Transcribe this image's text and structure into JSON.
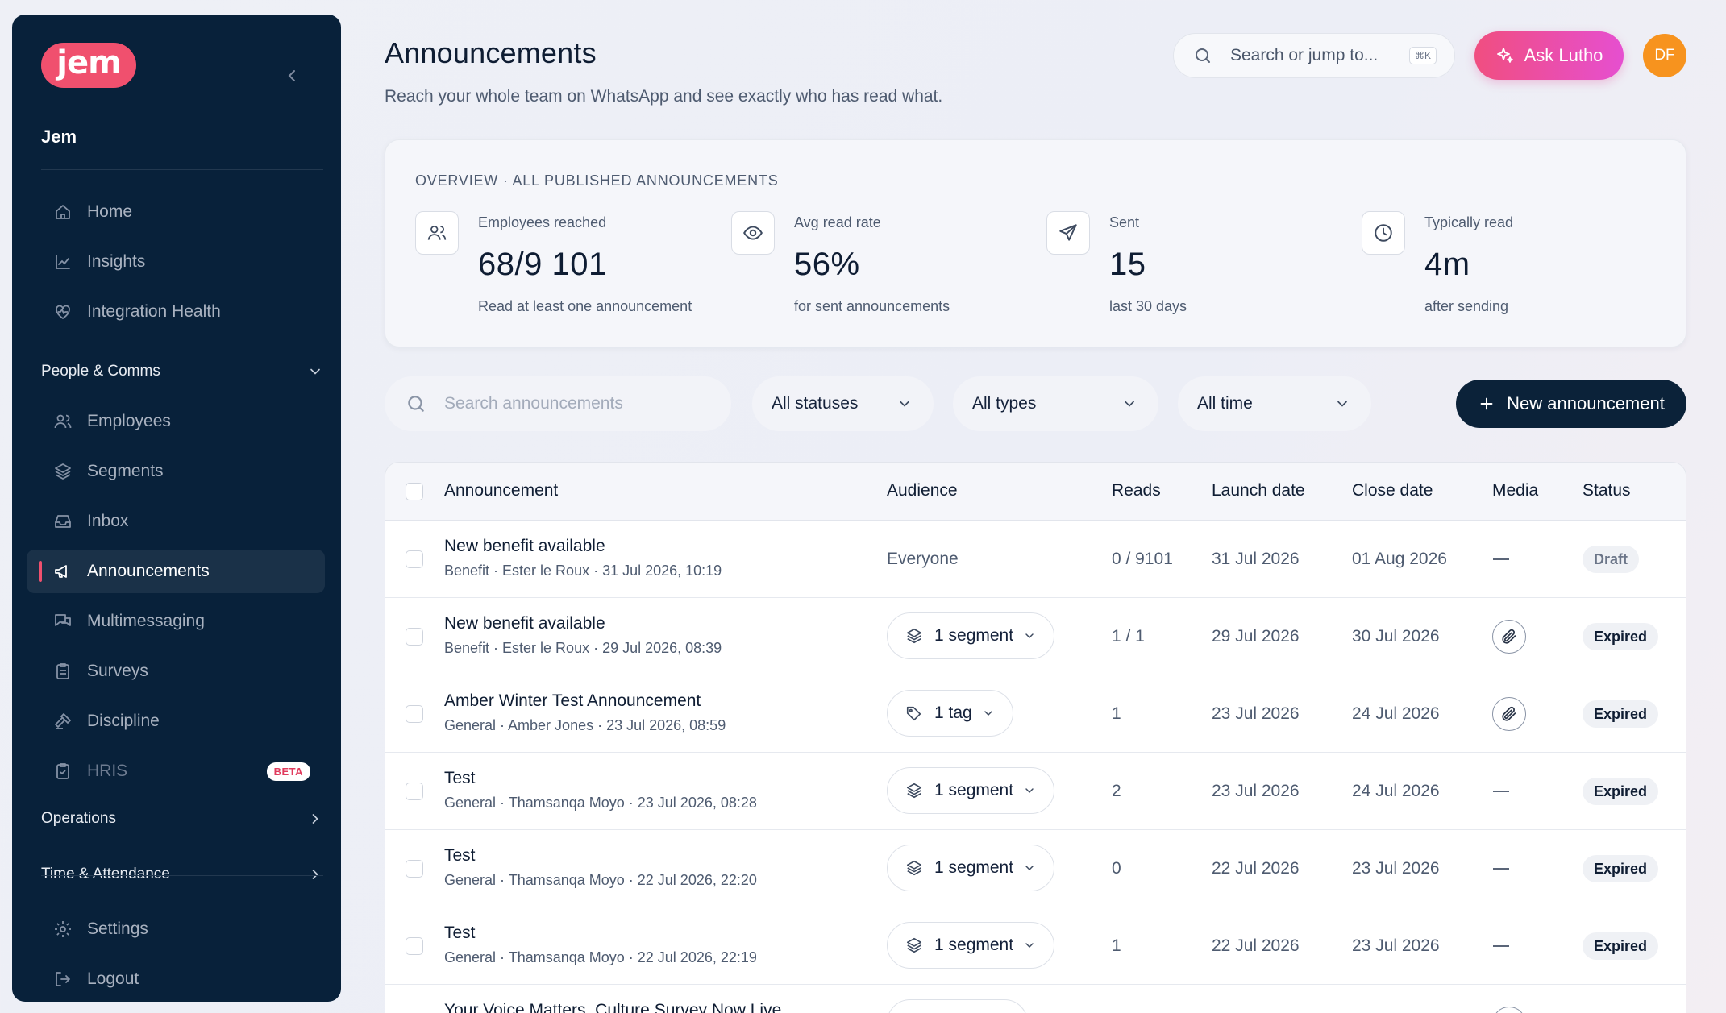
{
  "sidebar": {
    "logo": "jem",
    "org_name": "Jem",
    "items_top": [
      {
        "label": "Home",
        "icon": "home-icon"
      },
      {
        "label": "Insights",
        "icon": "chart-line-icon"
      },
      {
        "label": "Integration Health",
        "icon": "heart-pulse-icon"
      }
    ],
    "people_section": "People & Comms",
    "items_people": [
      {
        "label": "Employees",
        "icon": "users-icon"
      },
      {
        "label": "Segments",
        "icon": "layers-icon"
      },
      {
        "label": "Inbox",
        "icon": "inbox-icon"
      },
      {
        "label": "Announcements",
        "icon": "megaphone-icon",
        "active": true
      },
      {
        "label": "Multimessaging",
        "icon": "chat-icon"
      },
      {
        "label": "Surveys",
        "icon": "clipboard-icon"
      },
      {
        "label": "Discipline",
        "icon": "gavel-icon"
      },
      {
        "label": "HRIS",
        "icon": "clipboard-check-icon",
        "badge": "BETA"
      }
    ],
    "operations_section": "Operations",
    "time_section": "Time & Attendance",
    "items_bottom": [
      {
        "label": "Settings",
        "icon": "gear-icon"
      },
      {
        "label": "Logout",
        "icon": "logout-icon"
      }
    ]
  },
  "header": {
    "title": "Announcements",
    "subtitle": "Reach your whole team on WhatsApp and see exactly who has read what.",
    "search_placeholder": "Search or jump to...",
    "search_shortcut": "⌘K",
    "ask_label": "Ask Lutho",
    "avatar_initials": "DF"
  },
  "overview": {
    "label": "OVERVIEW · ALL PUBLISHED ANNOUNCEMENTS",
    "stats": [
      {
        "label": "Employees reached",
        "value": "68/9 101",
        "sub": "Read at least one announcement",
        "icon": "users-icon"
      },
      {
        "label": "Avg read rate",
        "value": "56%",
        "sub": "for sent announcements",
        "icon": "eye-icon"
      },
      {
        "label": "Sent",
        "value": "15",
        "sub": "last 30 days",
        "icon": "send-icon"
      },
      {
        "label": "Typically read",
        "value": "4m",
        "sub": "after sending",
        "icon": "clock-icon"
      }
    ]
  },
  "filters": {
    "search_placeholder": "Search announcements",
    "status": "All statuses",
    "type": "All types",
    "time": "All time",
    "new_label": "New announcement"
  },
  "table": {
    "headers": {
      "announcement": "Announcement",
      "audience": "Audience",
      "reads": "Reads",
      "launch": "Launch date",
      "close": "Close date",
      "media": "Media",
      "status": "Status"
    },
    "rows": [
      {
        "title": "New benefit available",
        "meta": "Benefit · Ester le Roux · 31 Jul 2026, 10:19",
        "audience": "Everyone",
        "audience_type": "text",
        "reads": "0 / 9101",
        "launch": "31 Jul 2026",
        "close": "01 Aug 2026",
        "media": false,
        "status": "Draft"
      },
      {
        "title": "New benefit available",
        "meta": "Benefit · Ester le Roux · 29 Jul 2026, 08:39",
        "audience": "1 segment",
        "audience_type": "segment",
        "reads": "1 / 1",
        "launch": "29 Jul 2026",
        "close": "30 Jul 2026",
        "media": true,
        "status": "Expired"
      },
      {
        "title": "Amber Winter Test Announcement",
        "meta": "General · Amber Jones · 23 Jul 2026, 08:59",
        "audience": "1 tag",
        "audience_type": "tag",
        "reads": "1",
        "launch": "23 Jul 2026",
        "close": "24 Jul 2026",
        "media": true,
        "status": "Expired"
      },
      {
        "title": "Test",
        "meta": "General · Thamsanqa Moyo · 23 Jul 2026, 08:28",
        "audience": "1 segment",
        "audience_type": "segment",
        "reads": "2",
        "launch": "23 Jul 2026",
        "close": "24 Jul 2026",
        "media": false,
        "status": "Expired"
      },
      {
        "title": "Test",
        "meta": "General · Thamsanqa Moyo · 22 Jul 2026, 22:20",
        "audience": "1 segment",
        "audience_type": "segment",
        "reads": "0",
        "launch": "22 Jul 2026",
        "close": "23 Jul 2026",
        "media": false,
        "status": "Expired"
      },
      {
        "title": "Test",
        "meta": "General · Thamsanqa Moyo · 22 Jul 2026, 22:19",
        "audience": "1 segment",
        "audience_type": "segment",
        "reads": "1",
        "launch": "22 Jul 2026",
        "close": "23 Jul 2026",
        "media": false,
        "status": "Expired"
      },
      {
        "title": "Your Voice Matters, Culture Survey Now Live",
        "meta": "",
        "audience": "",
        "audience_type": "partial",
        "reads": "",
        "launch": "",
        "close": "",
        "media": false,
        "status": ""
      }
    ]
  }
}
